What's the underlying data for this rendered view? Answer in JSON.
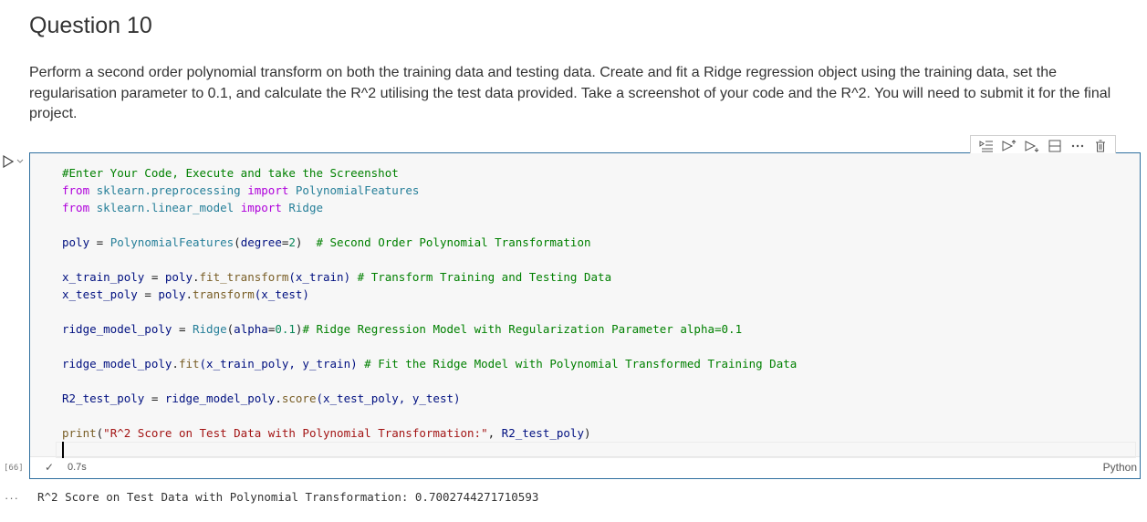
{
  "markdown": {
    "title": "Question 10",
    "paragraph": "Perform a second order polynomial transform on both the training data and testing data. Create and fit a Ridge regression object using the training data, set the regularisation parameter to 0.1, and calculate the R^2 utilising the test data provided. Take a screenshot of your code and the R^2. You will need to submit it for the final project."
  },
  "cell": {
    "toolbar_icons": [
      "run-by-line-icon",
      "execute-above-icon",
      "execute-below-icon",
      "split-cell-icon",
      "more-icon",
      "delete-icon"
    ],
    "execution_count": "[66]",
    "status_icon": "✓",
    "exec_time": "0.7s",
    "language": "Python",
    "code": {
      "l1": "#Enter Your Code, Execute and take the Screenshot",
      "l2_from": "from",
      "l2_mod": "sklearn.preprocessing",
      "l2_import": "import",
      "l2_name": "PolynomialFeatures",
      "l3_from": "from",
      "l3_mod": "sklearn.linear_model",
      "l3_import": "import",
      "l3_name": "Ridge",
      "l5_var": "poly",
      "l5_eq": " = ",
      "l5_cls": "PolynomialFeatures",
      "l5_open": "(",
      "l5_arg": "degree",
      "l5_op": "=",
      "l5_num": "2",
      "l5_close": ")  ",
      "l5_cm": "# Second Order Polynomial Transformation",
      "l7_var": "x_train_poly",
      "l7_eq": " = ",
      "l7_obj": "poly",
      "l7_dot": ".",
      "l7_fn": "fit_transform",
      "l7_args": "(x_train) ",
      "l7_cm": "# Transform Training and Testing Data",
      "l8_var": "x_test_poly",
      "l8_eq": " = ",
      "l8_obj": "poly",
      "l8_dot": ".",
      "l8_fn": "transform",
      "l8_args": "(x_test)",
      "l10_var": "ridge_model_poly",
      "l10_eq": " = ",
      "l10_cls": "Ridge",
      "l10_open": "(",
      "l10_arg": "alpha",
      "l10_op": "=",
      "l10_num": "0.1",
      "l10_close": ")",
      "l10_cm": "# Ridge Regression Model with Regularization Parameter alpha=0.1",
      "l12_obj": "ridge_model_poly",
      "l12_dot": ".",
      "l12_fn": "fit",
      "l12_args": "(x_train_poly, y_train) ",
      "l12_cm": "# Fit the Ridge Model with Polynomial Transformed Training Data",
      "l14_var": "R2_test_poly",
      "l14_eq": " = ",
      "l14_obj": "ridge_model_poly",
      "l14_dot": ".",
      "l14_fn": "score",
      "l14_args": "(x_test_poly, y_test)",
      "l16_fn": "print",
      "l16_open": "(",
      "l16_str": "\"R^2 Score on Test Data with Polynomial Transformation:\"",
      "l16_comma": ", ",
      "l16_var": "R2_test_poly",
      "l16_close": ")"
    }
  },
  "output": {
    "text": "R^2 Score on Test Data with Polynomial Transformation: 0.7002744271710593"
  },
  "colors": {
    "comment": "#008000",
    "keyword": "#af00db",
    "class": "#267f99",
    "function": "#795e26",
    "string": "#a31515",
    "number": "#098658",
    "variable": "#001080",
    "cell_border": "#2f6f9f"
  }
}
